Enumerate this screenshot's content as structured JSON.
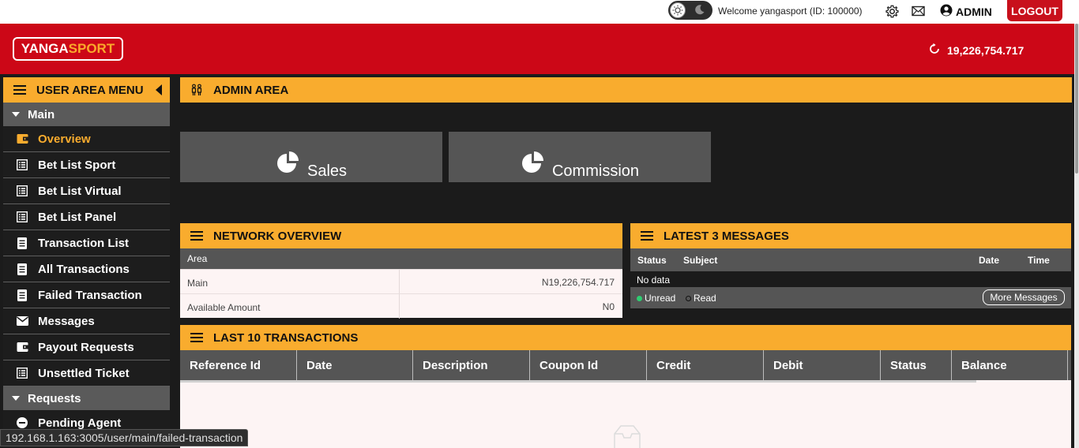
{
  "topbar": {
    "welcome": "Welcome yangasport (ID: 100000)",
    "admin_label": "ADMIN",
    "logout_label": "LOGOUT"
  },
  "brand": {
    "part1": "YANGA",
    "part2": "SPORT"
  },
  "header": {
    "balance": "19,226,754.717"
  },
  "sidebar": {
    "title": "USER AREA MENU",
    "groups": [
      {
        "label": "Main"
      },
      {
        "label": "Requests"
      }
    ],
    "items": [
      {
        "label": "Overview"
      },
      {
        "label": "Bet List Sport"
      },
      {
        "label": "Bet List Virtual"
      },
      {
        "label": "Bet List Panel"
      },
      {
        "label": "Transaction List"
      },
      {
        "label": "All Transactions"
      },
      {
        "label": "Failed Transaction"
      },
      {
        "label": "Messages"
      },
      {
        "label": "Payout Requests"
      },
      {
        "label": "Unsettled Ticket"
      },
      {
        "label": "Pending Agent"
      }
    ]
  },
  "admin_area": {
    "title": "ADMIN AREA",
    "cards": [
      {
        "label": "Sales"
      },
      {
        "label": "Commission"
      }
    ]
  },
  "network": {
    "title": "NETWORK OVERVIEW",
    "header": "Area",
    "rows": [
      {
        "key": "Main",
        "value": "N19,226,754.717"
      },
      {
        "key": "Available Amount",
        "value": "N0"
      }
    ]
  },
  "messages": {
    "title": "LATEST 3 MESSAGES",
    "columns": {
      "status": "Status",
      "subject": "Subject",
      "date": "Date",
      "time": "Time"
    },
    "no_data": "No data",
    "legend_unread": "Unread",
    "legend_read": "Read",
    "more_label": "More Messages"
  },
  "transactions": {
    "title": "LAST 10 TRANSACTIONS",
    "columns": [
      "Reference Id",
      "Date",
      "Description",
      "Coupon Id",
      "Credit",
      "Debit",
      "Status",
      "Balance"
    ]
  },
  "statusbar": {
    "url": "192.168.1.163:3005/user/main/failed-transaction"
  },
  "colors": {
    "accent": "#f9ac2e",
    "brand_red": "#cc0717",
    "panel_gray": "#555555"
  }
}
